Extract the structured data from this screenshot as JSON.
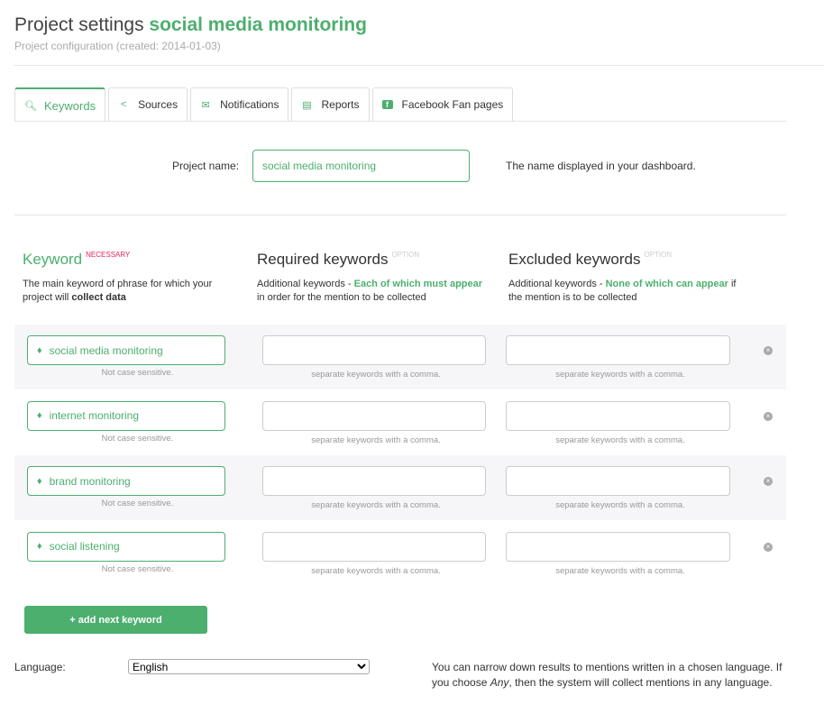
{
  "header": {
    "title_prefix": "Project settings",
    "title_project": "social media monitoring",
    "subtitle": "Project configuration (created: 2014-01-03)"
  },
  "tabs": [
    {
      "label": "Keywords",
      "icon": "search-icon"
    },
    {
      "label": "Sources",
      "icon": "share-icon"
    },
    {
      "label": "Notifications",
      "icon": "envelope-icon"
    },
    {
      "label": "Reports",
      "icon": "document-icon"
    },
    {
      "label": "Facebook Fan pages",
      "icon": "facebook-icon"
    }
  ],
  "project_name": {
    "label": "Project name:",
    "value": "social media monitoring",
    "help": "The name displayed in your dashboard."
  },
  "columns": {
    "keyword": {
      "title": "Keyword",
      "badge": "NECESSARY",
      "desc1": "The main keyword of phrase for which your project will ",
      "desc_bold": "collect data"
    },
    "required": {
      "title": "Required keywords",
      "badge": "OPTION",
      "desc1": "Additional keywords - ",
      "desc_green": "Each of which must appear",
      "desc2": " in order for the mention to be collected"
    },
    "excluded": {
      "title": "Excluded keywords",
      "badge": "OPTION",
      "desc1": "Additional keywords - ",
      "desc_green": "None of which can appear",
      "desc2": " if the mention is to be collected"
    }
  },
  "keyword_hint": "Not case sensitive.",
  "comma_hint": "separate keywords with a comma.",
  "keywords": [
    "social media monitoring",
    "internet monitoring",
    "brand monitoring",
    "social listening"
  ],
  "add_button": "+ add next keyword",
  "language": {
    "label": "Language:",
    "value": "English",
    "help_1": "You can narrow down results to mentions written in a chosen language. If you choose ",
    "help_em": "Any",
    "help_2": ", then the system will collect mentions in any language."
  },
  "colors": {
    "accent": "#4caf6e",
    "necessary": "#e0245e"
  }
}
